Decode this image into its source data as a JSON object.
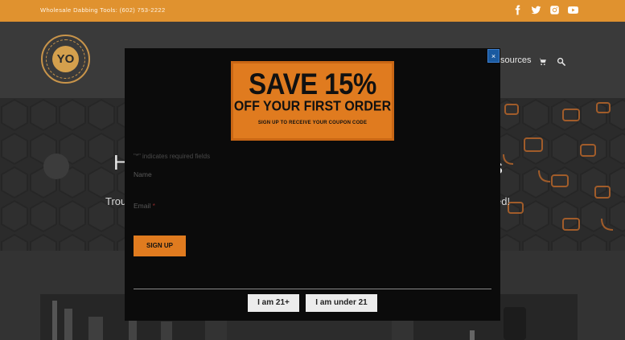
{
  "topbar": {
    "phone_text": "Wholesale Dabbing Tools: (602) 753-2222",
    "social_icons": [
      "facebook-icon",
      "twitter-icon",
      "instagram-icon",
      "youtube-icon"
    ]
  },
  "header": {
    "logo_text": "YO",
    "nav_partial_label": "sources",
    "icons": [
      "cart-icon",
      "search-icon"
    ]
  },
  "hero": {
    "heading_left_fragment": "H",
    "heading_right_fragment": "s",
    "text_left_fragment": "Trou",
    "text_right_fragment": "ed!"
  },
  "modal": {
    "close_label": "×",
    "promo": {
      "line1": "SAVE 15%",
      "line2": "OFF YOUR FIRST ORDER",
      "line3": "SIGN UP TO RECEIVE YOUR COUPON CODE"
    },
    "required_note": "\"*\" indicates required fields",
    "name_label": "Name",
    "email_label": "Email",
    "required_star": "*",
    "signup_label": "SIGN UP",
    "age_buttons": {
      "over_label": "I am 21+",
      "under_label": "I am under 21"
    }
  },
  "colors": {
    "accent_orange": "#e0922f",
    "promo_orange": "#e07b1f",
    "modal_bg": "#0b0b0b",
    "close_blue": "#1a5aa0"
  }
}
